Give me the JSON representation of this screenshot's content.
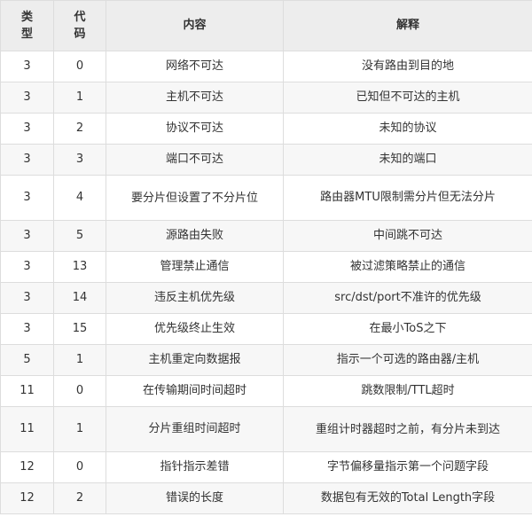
{
  "table": {
    "headers": {
      "type": "类型",
      "code": "代码",
      "content": "内容",
      "description": "解释"
    },
    "rows": [
      {
        "type": "3",
        "code": "0",
        "content": "网络不可达",
        "description": "没有路由到目的地"
      },
      {
        "type": "3",
        "code": "1",
        "content": "主机不可达",
        "description": "已知但不可达的主机"
      },
      {
        "type": "3",
        "code": "2",
        "content": "协议不可达",
        "description": "未知的协议"
      },
      {
        "type": "3",
        "code": "3",
        "content": "端口不可达",
        "description": "未知的端口"
      },
      {
        "type": "3",
        "code": "4",
        "content": "要分片但设置了不分片位",
        "description": "路由器MTU限制需分片但无法分片"
      },
      {
        "type": "3",
        "code": "5",
        "content": "源路由失败",
        "description": "中间跳不可达"
      },
      {
        "type": "3",
        "code": "13",
        "content": "管理禁止通信",
        "description": "被过滤策略禁止的通信"
      },
      {
        "type": "3",
        "code": "14",
        "content": "违反主机优先级",
        "description": "src/dst/port不准许的优先级"
      },
      {
        "type": "3",
        "code": "15",
        "content": "优先级终止生效",
        "description": "在最小ToS之下"
      },
      {
        "type": "5",
        "code": "1",
        "content": "主机重定向数据报",
        "description": "指示一个可选的路由器/主机"
      },
      {
        "type": "11",
        "code": "0",
        "content": "在传输期间时间超时",
        "description": "跳数限制/TTL超时"
      },
      {
        "type": "11",
        "code": "1",
        "content": "分片重组时间超时",
        "description": "重组计时器超时之前，有分片未到达"
      },
      {
        "type": "12",
        "code": "0",
        "content": "指针指示差错",
        "description": "字节偏移量指示第一个问题字段"
      },
      {
        "type": "12",
        "code": "2",
        "content": "错误的长度",
        "description": "数据包有无效的Total Length字段"
      }
    ]
  }
}
